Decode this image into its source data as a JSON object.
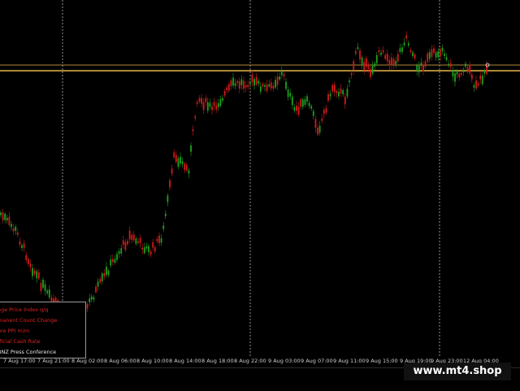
{
  "chart_data": {
    "type": "candlestick",
    "x_labels": [
      "7 Aug 17:00",
      "7 Aug 21:00",
      "8 Aug 02:00",
      "8 Aug 06:00",
      "8 Aug 10:00",
      "8 Aug 14:00",
      "8 Aug 18:00",
      "8 Aug 22:00",
      "9 Aug 03:00",
      "9 Aug 07:00",
      "9 Aug 11:00",
      "9 Aug 15:00",
      "9 Aug 19:00",
      "9 Aug 23:00",
      "12 Aug 04:00"
    ],
    "up_color": "#1fa01f",
    "down_color": "#d21b1b",
    "level_color": "#e8b84a",
    "grid_color": "#cccccc"
  },
  "news": {
    "items": [
      "age Price Index q/q",
      "manent Count Change",
      "ore PPI m/m",
      "fficial Cash Rate",
      "BNZ Press Conference"
    ]
  },
  "watermark": "www.mt4.shop"
}
